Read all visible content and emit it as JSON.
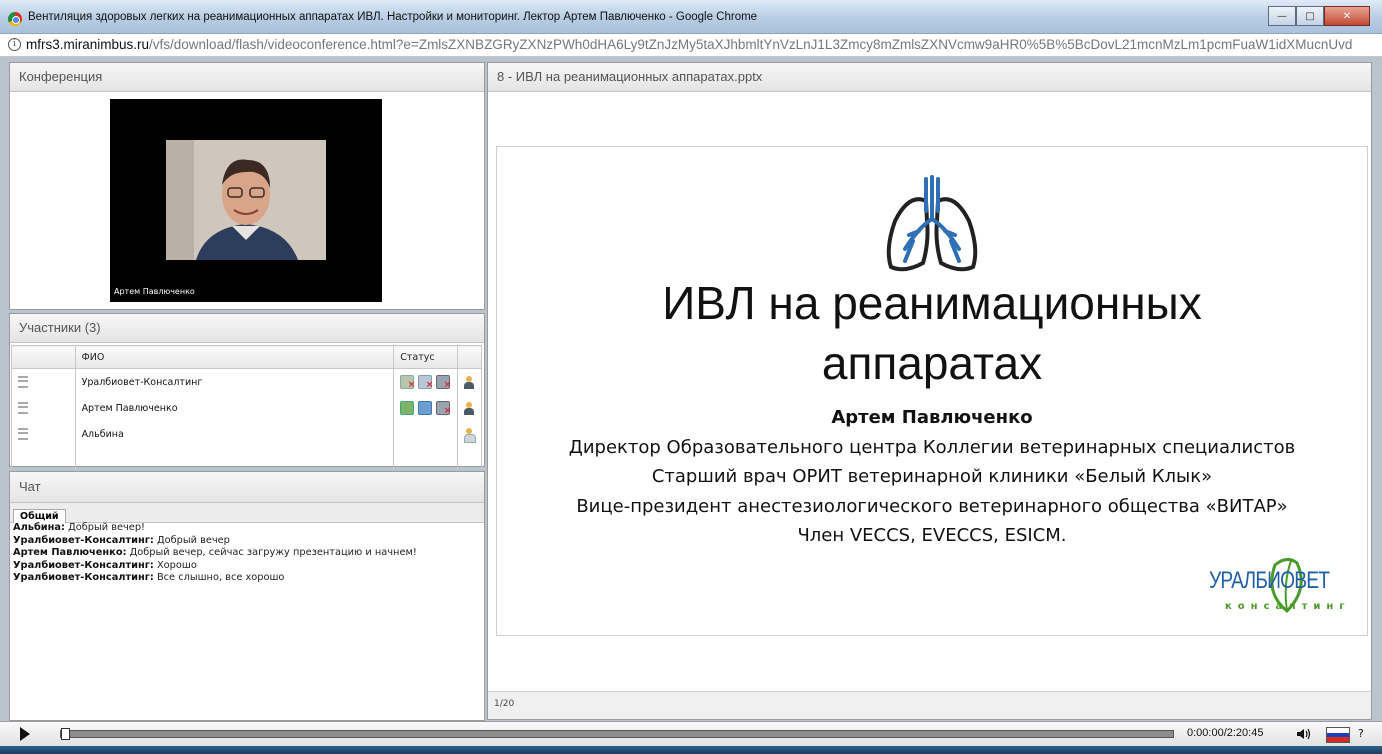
{
  "window": {
    "title": "Вентиляция здоровых легких на реанимационных аппаратах ИВЛ. Настройки и мониторинг. Лектор Артем Павлюченко - Google Chrome"
  },
  "address": {
    "host": "mfrs3.miranimbus.ru",
    "path": "/vfs/download/flash/videoconference.html?e=ZmlsZXNBZGRyZXNzPWh0dHA6Ly9tZnJzMy5taXJhbmltYnVzLnJ1L3Zmcy8mZmlsZXNVcmw9aHR0%5B%5BcDovL21mcnMzLm1pcmFuaW1idXMucnUvd"
  },
  "conference": {
    "title": "Конференция",
    "speaker_name": "Артем Павлюченко"
  },
  "participants": {
    "title": "Участники (3)",
    "col_name": "ФИО",
    "col_status": "Статус",
    "rows": [
      {
        "name": "Уралбиовет-Консалтинг"
      },
      {
        "name": "Артем Павлюченко"
      },
      {
        "name": "Альбина"
      }
    ]
  },
  "chat": {
    "title": "Чат",
    "tab": "Общий",
    "messages": [
      {
        "author": "Альбина:",
        "text": " Добрый вечер!"
      },
      {
        "author": "Уралбиовет-Консалтинг:",
        "text": " Добрый вечер"
      },
      {
        "author": "Артем Павлюченко:",
        "text": " Добрый вечер, сейчас загружу презентацию и начнем!"
      },
      {
        "author": "Уралбиовет-Консалтинг:",
        "text": " Хорошо"
      },
      {
        "author": "Уралбиовет-Консалтинг:",
        "text": " Все слышно, все хорошо"
      }
    ]
  },
  "presentation": {
    "title": "8 - ИВЛ на реанимационных аппаратах.pptx",
    "slide_title_1": "ИВЛ на реанимационных",
    "slide_title_2": "аппаратах",
    "author": "Артем Павлюченко",
    "lines": [
      "Директор Образовательного центра Коллегии ветеринарных специалистов",
      "Старший врач ОРИТ ветеринарной клиники «Белый Клык»",
      "Вице-президент анестезиологического ветеринарного общества «ВИТАР»",
      "Член VECCS, EVECCS, ESICM."
    ],
    "logo_text_1": "УРАЛБИОВЕТ",
    "logo_text_2": "консалтинг",
    "page": "1/20"
  },
  "player": {
    "time": "0:00:00/2:20:45",
    "progress": 0,
    "help": "?"
  },
  "colors": {
    "lungs": "#2f6fb5",
    "logo_blue": "#1f5fa8",
    "logo_green": "#4a9a2a"
  }
}
